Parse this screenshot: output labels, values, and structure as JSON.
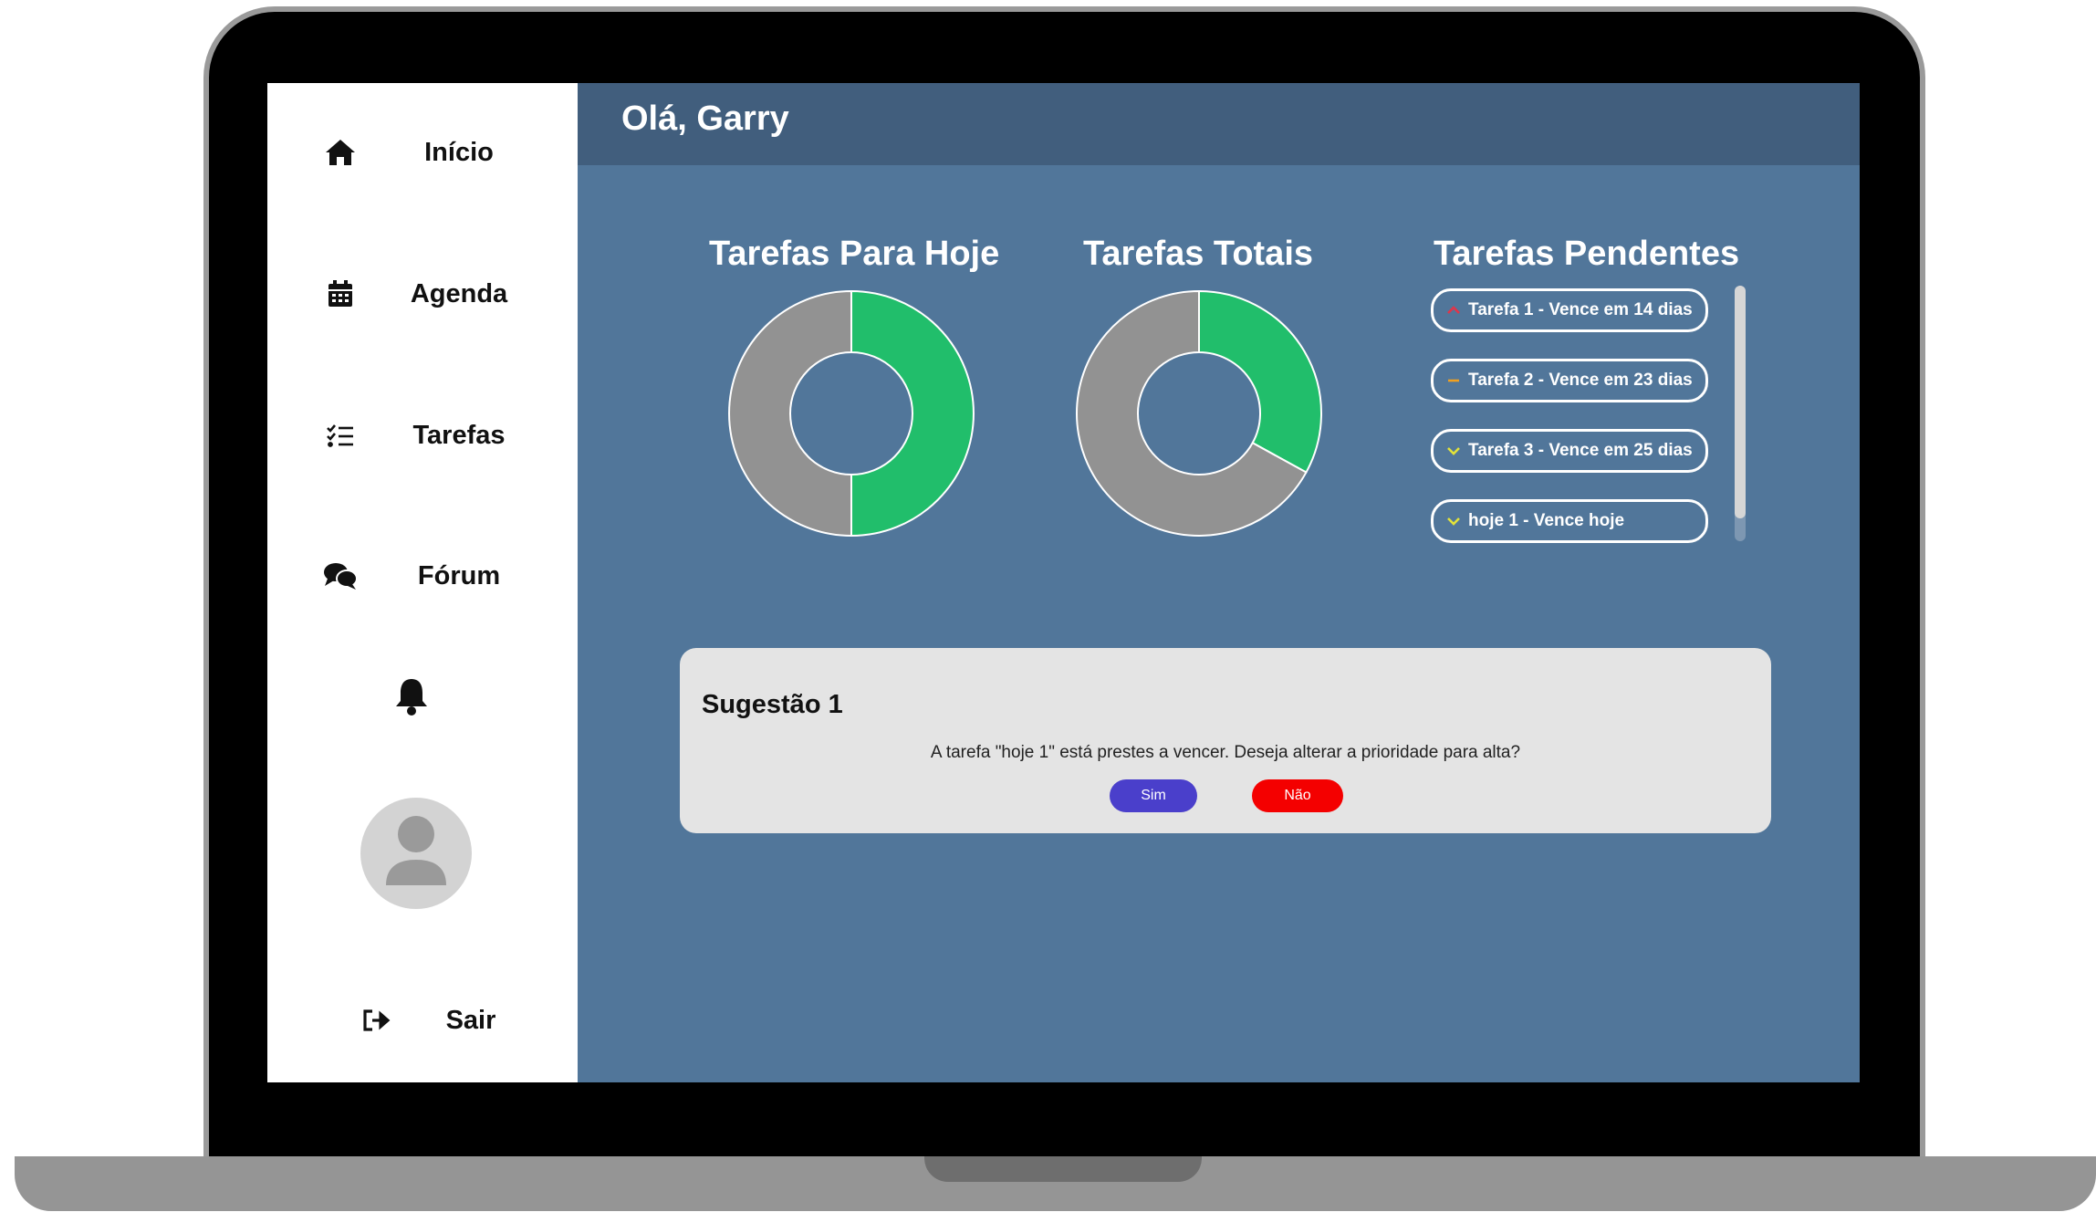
{
  "sidebar": {
    "items": [
      {
        "label": "Início",
        "icon": "home-icon"
      },
      {
        "label": "Agenda",
        "icon": "calendar-icon"
      },
      {
        "label": "Tarefas",
        "icon": "task-list-icon"
      },
      {
        "label": "Fórum",
        "icon": "chat-icon"
      }
    ],
    "notifications_icon": "bell-icon",
    "avatar_icon": "user-avatar-icon",
    "logout": {
      "label": "Sair",
      "icon": "logout-icon"
    }
  },
  "header": {
    "greeting": "Olá, Garry"
  },
  "panels": {
    "today": {
      "title": "Tarefas Para Hoje"
    },
    "total": {
      "title": "Tarefas Totais"
    },
    "pending": {
      "title": "Tarefas Pendentes"
    }
  },
  "chart_data": [
    {
      "type": "pie",
      "title": "Tarefas Para Hoje",
      "slices": [
        {
          "value": 0.5,
          "color": "#21be6b"
        },
        {
          "value": 0.5,
          "color": "#929292"
        }
      ]
    },
    {
      "type": "pie",
      "title": "Tarefas Totais",
      "slices": [
        {
          "value": 0.33,
          "color": "#21be6b"
        },
        {
          "value": 0.67,
          "color": "#929292"
        }
      ]
    }
  ],
  "pending_tasks": [
    {
      "label": "Tarefa 1 - Vence em 14 dias",
      "priority": "high",
      "icon": "chevron-up-icon",
      "color": "#e0354a"
    },
    {
      "label": "Tarefa 2 - Vence em 23 dias",
      "priority": "medium",
      "icon": "dash-icon",
      "color": "#f0a020"
    },
    {
      "label": "Tarefa 3 - Vence em 25 dias",
      "priority": "low",
      "icon": "chevron-down-icon",
      "color": "#e2e23a"
    },
    {
      "label": "hoje 1 - Vence hoje",
      "priority": "low",
      "icon": "chevron-down-icon",
      "color": "#e2e23a"
    }
  ],
  "suggestion": {
    "title": "Sugestão 1",
    "text": "A tarefa \"hoje 1\" está prestes a vencer. Deseja alterar a prioridade para alta?",
    "yes_label": "Sim",
    "no_label": "Não"
  },
  "colors": {
    "screen_bg": "#51769a",
    "header_bg": "#415e7d",
    "done": "#21be6b",
    "pending": "#929292",
    "yes_button": "#4a3fcb",
    "no_button": "#f40000"
  }
}
